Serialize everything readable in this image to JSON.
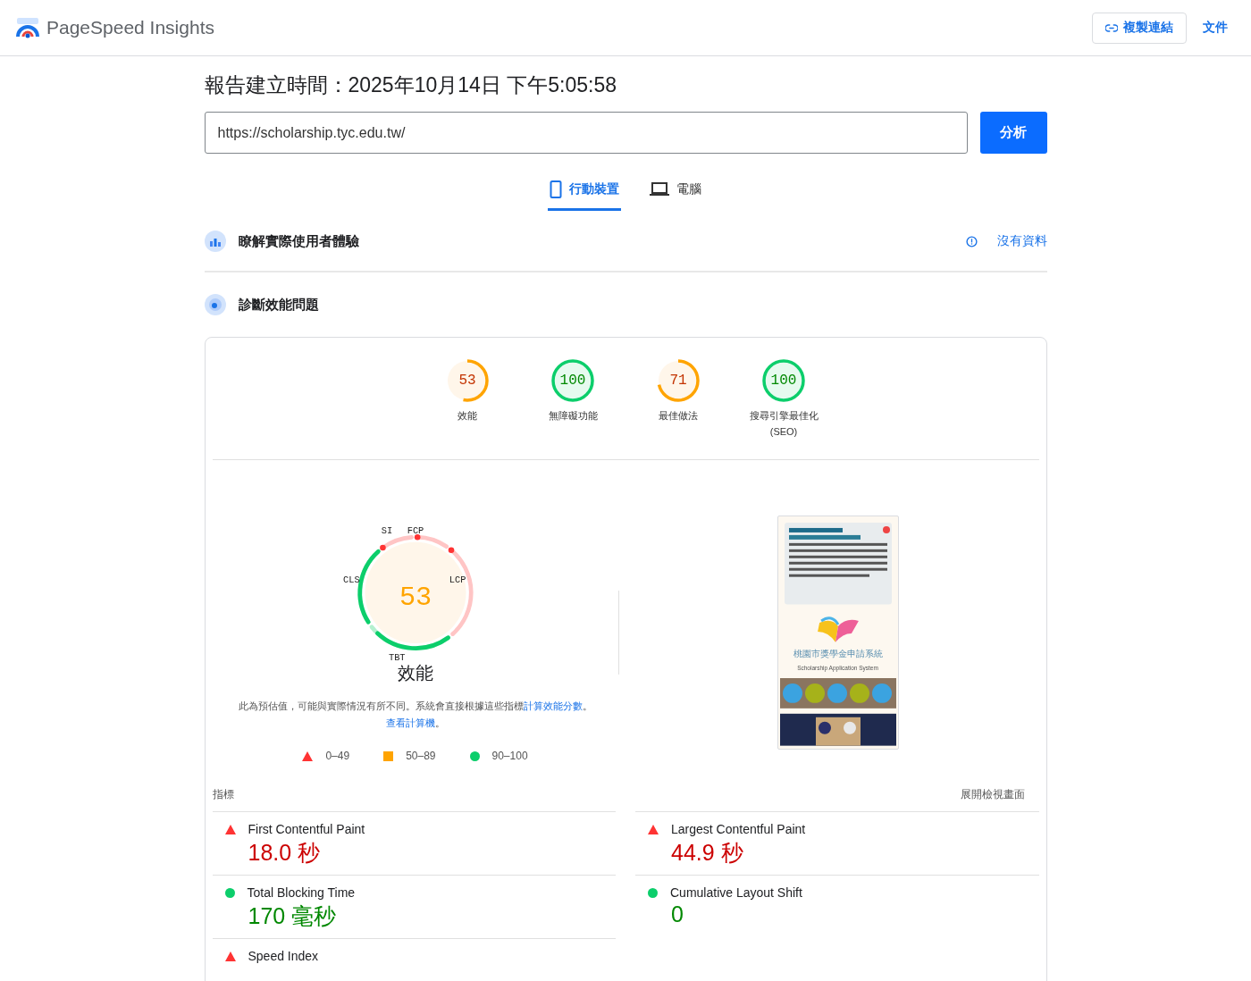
{
  "header": {
    "title": "PageSpeed Insights",
    "copy_link": "複製連結",
    "docs": "文件"
  },
  "report_time": "報告建立時間：2025年10月14日 下午5:05:58",
  "url": "https://scholarship.tyc.edu.tw/",
  "analyze_button": "分析",
  "tabs": [
    {
      "label": "行動裝置",
      "selected": true
    },
    {
      "label": "電腦",
      "selected": false
    }
  ],
  "field_section": {
    "title": "瞭解實際使用者體驗",
    "status": "沒有資料"
  },
  "lab_section": {
    "title": "診斷效能問題"
  },
  "categories": [
    {
      "score": "53",
      "label": "效能",
      "color": "#ffa400"
    },
    {
      "score": "100",
      "label": "無障礙功能",
      "color": "#0cce6b"
    },
    {
      "score": "71",
      "label": "最佳做法",
      "color": "#ffa400"
    },
    {
      "score": "100",
      "label": "搜尋引擎最佳化",
      "sublabel": "(SEO)",
      "color": "#0cce6b"
    }
  ],
  "performance": {
    "score": "53",
    "color": "#ffa400",
    "title": "效能",
    "segments": [
      {
        "label": "FCP",
        "color": "#ff3333"
      },
      {
        "label": "LCP",
        "color": "#ff3333"
      },
      {
        "label": "TBT",
        "color": "#0cce6b"
      },
      {
        "label": "CLS",
        "color": "#0cce6b"
      },
      {
        "label": "SI",
        "color": "#ff3333"
      }
    ],
    "note": {
      "before": "此為預估值，可能與實際情況有所不同。系統會直接根據這些指標",
      "score_link": "計算效能分數",
      "between": "。",
      "calculator_link": "查看計算機",
      "after": "。"
    }
  },
  "legend": [
    {
      "kind": "triangle",
      "color": "#ff3333",
      "range": "0–49"
    },
    {
      "kind": "square",
      "color": "#ffa400",
      "range": "50–89"
    },
    {
      "kind": "circle",
      "color": "#0cce6b",
      "range": "90–100"
    }
  ],
  "thumbnail": {
    "kind": "picture",
    "title": "桃園市獎學金申請系統",
    "subtitle": "Scholarship Application System"
  },
  "metrics_header": {
    "label": "指標",
    "toggle": "展開檢視畫面"
  },
  "metrics": [
    {
      "name": "First Contentful Paint",
      "value": "18.0 秒",
      "kind": "triangle",
      "color": "#ff3333"
    },
    {
      "name": "Largest Contentful Paint",
      "value": "44.9 秒",
      "kind": "triangle",
      "color": "#ff3333"
    },
    {
      "name": "Total Blocking Time",
      "value": "170 毫秒",
      "kind": "circle",
      "color": "#0cce6b"
    },
    {
      "name": "Cumulative Layout Shift",
      "value": "0",
      "kind": "circle",
      "color": "#0cce6b"
    },
    {
      "name": "Speed Index",
      "kind": "triangle",
      "color": "#ff3333"
    }
  ]
}
